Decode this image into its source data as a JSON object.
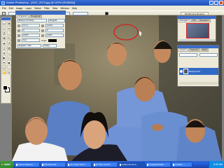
{
  "window": {
    "title": "Adobe Photoshop - [DSC_0074.jpg @ 100% (RGB/8#)]"
  },
  "menu": [
    "File",
    "Edit",
    "Image",
    "Layer",
    "Select",
    "Filter",
    "View",
    "Window",
    "Help"
  ],
  "options": {
    "font_family": "Arial",
    "font_style": "Regular",
    "size": "12 pt",
    "aa": "Sharp",
    "palette_well": "File Browser  Brushes"
  },
  "character_palette": {
    "tabs": [
      "Character",
      "Paragraph"
    ],
    "font_family": "Bodoni Xlt Stript",
    "font_style": "Regular",
    "size": "12 pt",
    "leading": "(Auto)",
    "tracking": "0",
    "kerning": "0",
    "vscale": "100%",
    "hscale": "100%",
    "baseline": "0 pt",
    "color_label": "Color:",
    "language": "English: USA",
    "aa": "Sharp"
  },
  "navigator": {
    "tabs": [
      "Navigator",
      "Info",
      "Histogram"
    ]
  },
  "layers": {
    "tabs": [
      "Layers",
      "Channels",
      "Paths"
    ],
    "blend": "Normal",
    "opacity": "100%",
    "layer_name": "Background"
  },
  "taskbar": {
    "start": "start",
    "buttons": [
      "Yahoo! Messen...",
      "Windows Me...",
      "On A New Gam...",
      "Dr Sano and hi...",
      "Adobe Photosh...",
      "ImageShack&#...",
      "Untitled - ..."
    ],
    "clock": "8:35 AM"
  },
  "colors": {
    "foreground": "#000000",
    "background": "#ffffff",
    "selection": "#d22020"
  }
}
